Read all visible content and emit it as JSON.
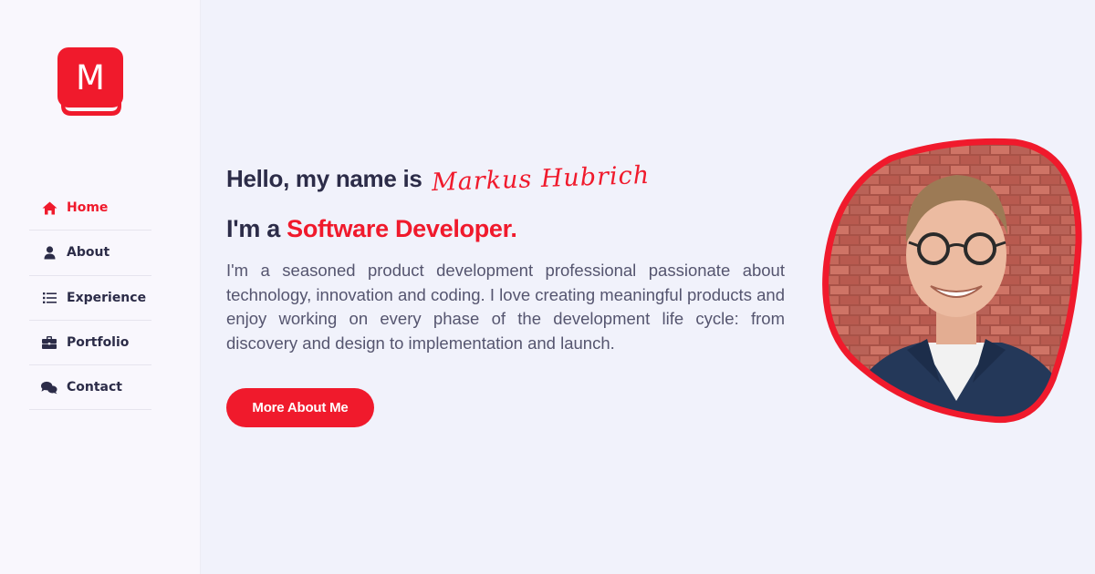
{
  "logo": {
    "letter": "M",
    "color": "#f01a2c"
  },
  "nav": {
    "items": [
      {
        "label": "Home",
        "icon": "home-icon",
        "active": true
      },
      {
        "label": "About",
        "icon": "user-icon",
        "active": false
      },
      {
        "label": "Experience",
        "icon": "list-icon",
        "active": false
      },
      {
        "label": "Portfolio",
        "icon": "briefcase-icon",
        "active": false
      },
      {
        "label": "Contact",
        "icon": "chat-bubbles-icon",
        "active": false
      }
    ]
  },
  "hero": {
    "greeting": "Hello, my name is",
    "name": "Markus Hubrich",
    "role_prefix": "I'm a",
    "role": "Software Developer.",
    "bio": "I'm a seasoned product development professional passionate about technology, innovation and coding. I love creating meaningful products and enjoy working on every phase of the development life cycle: from discovery and design to implementation and launch.",
    "cta_label": "More About Me"
  },
  "colors": {
    "accent": "#f01a2c",
    "text_dark": "#2c2c48",
    "text_body": "#55556f",
    "sidebar_bg": "#f9f7fd",
    "page_bg": "#f1f2fb"
  }
}
